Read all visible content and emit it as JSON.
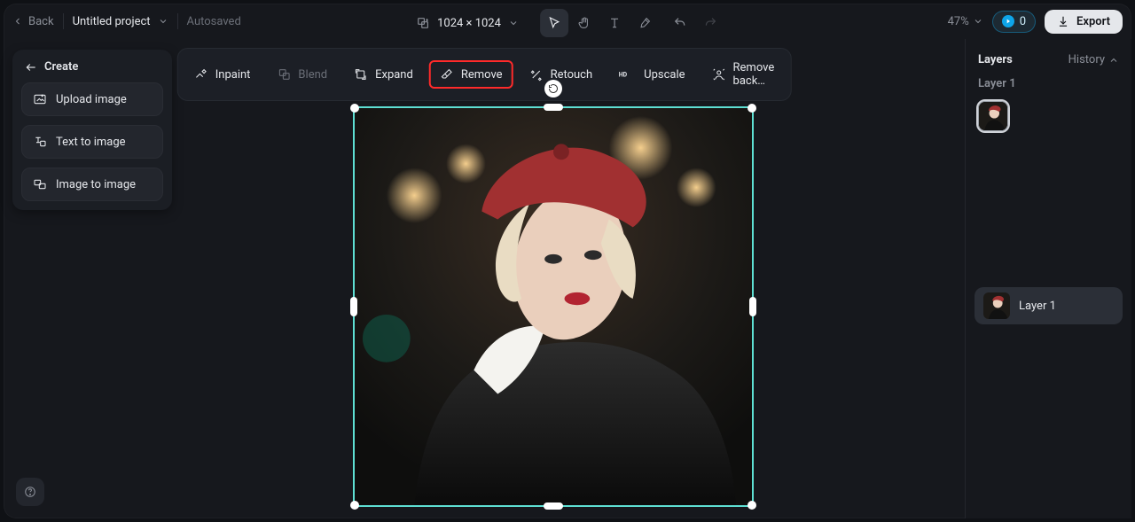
{
  "header": {
    "back_label": "Back",
    "project_title": "Untitled project",
    "autosaved_label": "Autosaved",
    "dimensions_label": "1024 × 1024",
    "zoom_label": "47%",
    "credits_count": "0",
    "export_label": "Export"
  },
  "create_panel": {
    "title": "Create",
    "upload_label": "Upload image",
    "text_to_image_label": "Text to image",
    "image_to_image_label": "Image to image"
  },
  "ai_toolbar": {
    "inpaint": "Inpaint",
    "blend": "Blend",
    "expand": "Expand",
    "remove": "Remove",
    "retouch": "Retouch",
    "upscale": "Upscale",
    "remove_bg": "Remove back…"
  },
  "top_tools": {
    "select_icon": "cursor-icon",
    "hand_icon": "hand-icon",
    "text_icon": "text-icon",
    "brush_icon": "brush-icon",
    "undo_icon": "undo-icon",
    "redo_icon": "redo-icon",
    "crop_icon": "crop-swap-icon"
  },
  "layers_panel": {
    "title": "Layers",
    "history_label": "History",
    "current_layer_title": "Layer 1",
    "list": [
      {
        "name": "Layer 1"
      }
    ]
  },
  "help_label": "?"
}
